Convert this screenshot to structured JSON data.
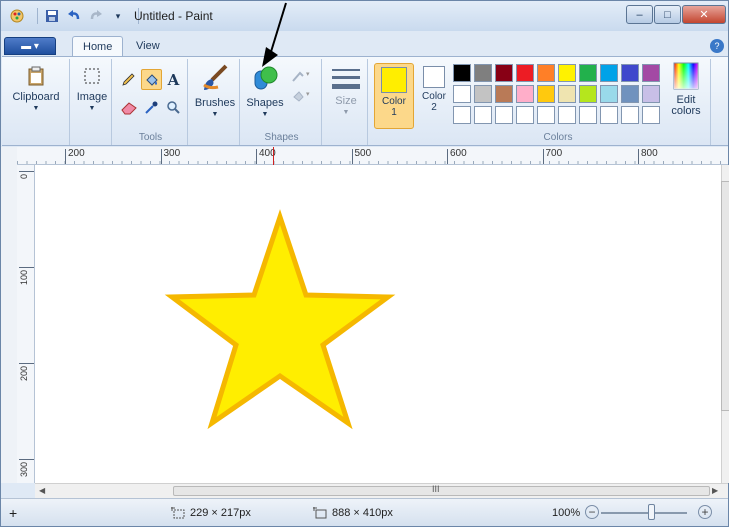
{
  "window": {
    "title": "Untitled - Paint",
    "minimize_label": "–",
    "maximize_label": "□",
    "close_label": "✕"
  },
  "tabs": {
    "file_label": "▬ ▾",
    "home": "Home",
    "view": "View",
    "help_label": "?"
  },
  "ribbon": {
    "clipboard": {
      "label": "Clipboard"
    },
    "image": {
      "label": "Image"
    },
    "tools": {
      "group_label": "Tools"
    },
    "brushes": {
      "label": "Brushes"
    },
    "shapes": {
      "label": "Shapes",
      "group_label": "Shapes"
    },
    "size": {
      "label": "Size"
    },
    "color1": {
      "label": "Color",
      "number": "1",
      "color": "#ffee00"
    },
    "color2": {
      "label": "Color",
      "number": "2",
      "color": "#ffffff"
    },
    "colors": {
      "group_label": "Colors"
    },
    "edit_colors": {
      "label": "Edit colors"
    },
    "palette": [
      [
        "#000000",
        "#7f7f7f",
        "#880015",
        "#ed1c24",
        "#ff7f27",
        "#fff200",
        "#22b14c",
        "#00a2e8",
        "#3f48cc",
        "#a349a4"
      ],
      [
        "#ffffff",
        "#c3c3c3",
        "#b97a57",
        "#ffaec9",
        "#ffc90e",
        "#efe4b0",
        "#b5e61d",
        "#99d9ea",
        "#7092be",
        "#c8bfe7"
      ],
      [
        "#ffffff",
        "#ffffff",
        "#ffffff",
        "#ffffff",
        "#ffffff",
        "#ffffff",
        "#ffffff",
        "#ffffff",
        "#ffffff",
        "#ffffff"
      ]
    ]
  },
  "ruler_h": [
    "200",
    "300",
    "400",
    "500",
    "600",
    "700",
    "800"
  ],
  "ruler_v": [
    "0",
    "100",
    "200",
    "300"
  ],
  "canvas": {
    "star_fill": "#ffee00",
    "star_outline": "#f5b800"
  },
  "scrollbar": {
    "grip": "III"
  },
  "status": {
    "selection_size": "229 × 217px",
    "image_size": "888 × 410px",
    "zoom": "100%",
    "zoom_out_label": "−",
    "zoom_in_label": "+"
  }
}
